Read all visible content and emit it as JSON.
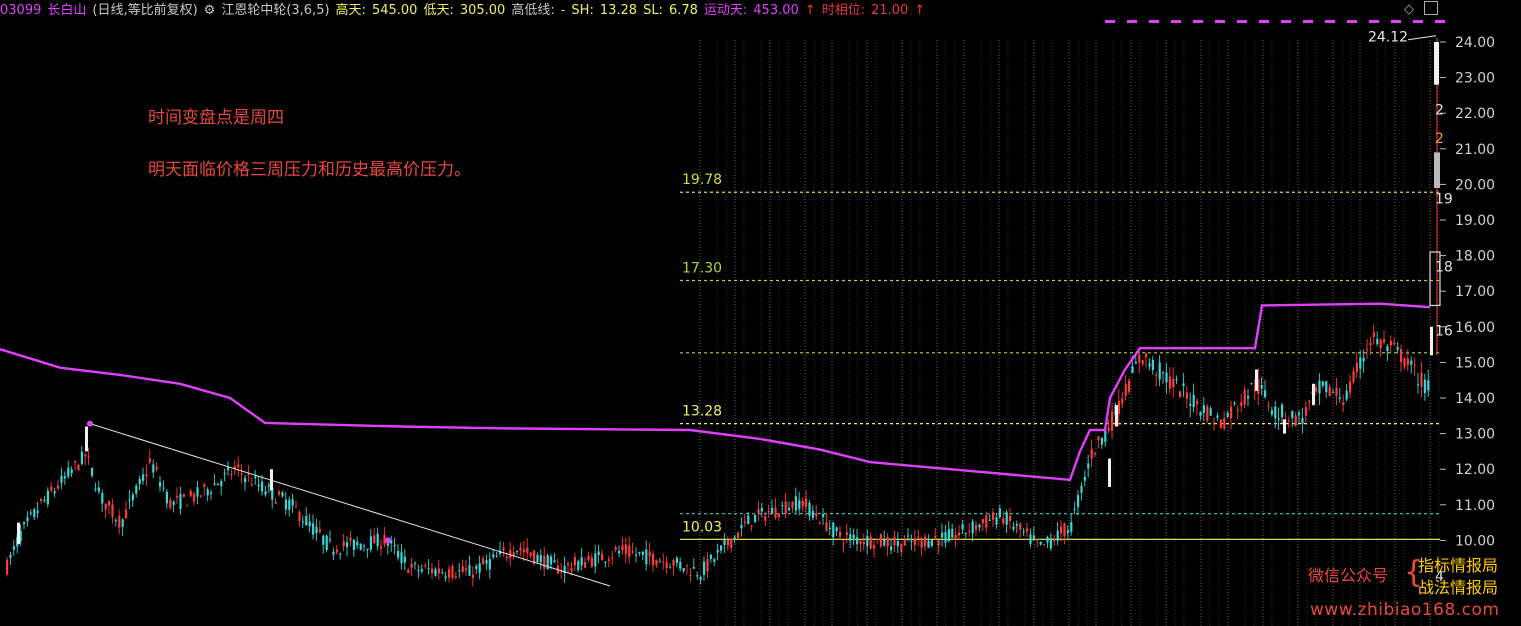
{
  "header": {
    "code": "03099",
    "name": "长白山",
    "period": "(日线,等比前复权)",
    "indicator_icon": "gear-icon",
    "indicator": "江恩轮中轮(3,6,5)",
    "high_label": "高天:",
    "high_value": "545.00",
    "low_label": "低天:",
    "low_value": "305.00",
    "hl_label": "高低线:",
    "hl_value": "-",
    "sh_label": "SH:",
    "sh_value": "13.28",
    "sl_label": "SL:",
    "sl_value": "6.78",
    "yd_label": "运动天:",
    "yd_value": "453.00",
    "sx_label": "时相位:",
    "sx_value": "21.00",
    "arrow": "↑"
  },
  "annotations": [
    "时间变盘点是周四",
    "明天面临价格三周压力和历史最高价压力。"
  ],
  "watermark": {
    "left": "微信公众号",
    "top": "指标情报局",
    "bottom": "战法情报局",
    "url": "www.zhibiao168.com"
  },
  "chart_data": {
    "type": "candlestick",
    "y_axis": {
      "range": [
        9.0,
        24.5
      ],
      "ticks": [
        "24.00",
        "23.00",
        "22.00",
        "21.00",
        "20.00",
        "19.00",
        "18.00",
        "17.00",
        "16.00",
        "15.00",
        "14.00",
        "13.00",
        "12.00",
        "11.00",
        "10.00"
      ],
      "position": "right"
    },
    "price_levels": [
      {
        "label": "19.78",
        "value": 19.78,
        "color": "#d8d840"
      },
      {
        "label": "17.30",
        "value": 17.3,
        "color": "#a8d840"
      },
      {
        "label": "",
        "value": 15.27,
        "color": "#a8d840"
      },
      {
        "label": "13.28",
        "value": 13.28,
        "color": "#f0f060"
      },
      {
        "label": "",
        "value": 10.75,
        "color": "#40c8c8"
      },
      {
        "label": "10.03",
        "value": 10.03,
        "color": "#f0f060"
      }
    ],
    "max_label": "24.12",
    "right_edge_labels": [
      "2",
      "2",
      "19",
      "18",
      "16",
      "4"
    ],
    "moving_line": [
      [
        0,
        15.37
      ],
      [
        60,
        14.85
      ],
      [
        120,
        14.65
      ],
      [
        180,
        14.4
      ],
      [
        230,
        14.0
      ],
      [
        265,
        13.3
      ],
      [
        400,
        13.2
      ],
      [
        500,
        13.15
      ],
      [
        690,
        13.1
      ],
      [
        760,
        12.85
      ],
      [
        820,
        12.55
      ],
      [
        870,
        12.2
      ],
      [
        950,
        12.0
      ],
      [
        1010,
        11.85
      ],
      [
        1070,
        11.7
      ],
      [
        1080,
        12.5
      ],
      [
        1090,
        13.1
      ],
      [
        1105,
        13.1
      ],
      [
        1110,
        14.0
      ],
      [
        1125,
        14.8
      ],
      [
        1140,
        15.4
      ],
      [
        1255,
        15.4
      ],
      [
        1262,
        16.6
      ],
      [
        1380,
        16.65
      ],
      [
        1430,
        16.55
      ]
    ],
    "trendline": [
      [
        90,
        13.28
      ],
      [
        610,
        9.0
      ]
    ],
    "pivot_points": [
      [
        90,
        13.28
      ],
      [
        388,
        10.0
      ]
    ]
  }
}
